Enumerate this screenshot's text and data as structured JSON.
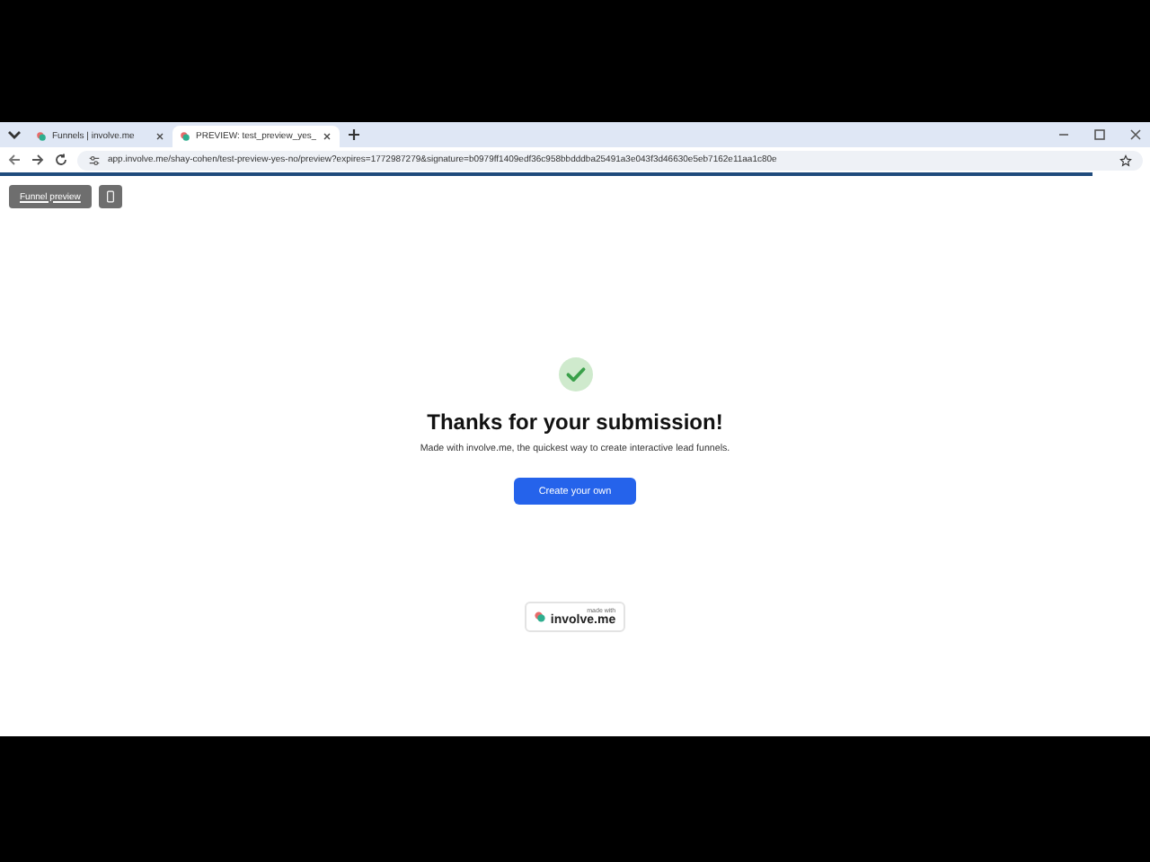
{
  "browser": {
    "tabs": [
      {
        "title": "Funnels | involve.me",
        "selected": false
      },
      {
        "title": "PREVIEW: test_preview_yes_",
        "selected": true
      }
    ],
    "url": "app.involve.me/shay-cohen/test-preview-yes-no/preview?expires=1772987279&signature=b0979ff1409edf36c958bbdddba25491a3e043f3d46630e5eb7162e11aa1c80e",
    "load_progress": {
      "level": 0.95
    }
  },
  "toolbar": {
    "button": "Funnel preview"
  },
  "content": {
    "title": "Thanks for your submission!",
    "subtitle": "Made with involve.me, the quickest way to create interactive lead funnels.",
    "button": "Create your own"
  },
  "badge": {
    "caption": "made with",
    "brand": "involve.me"
  }
}
